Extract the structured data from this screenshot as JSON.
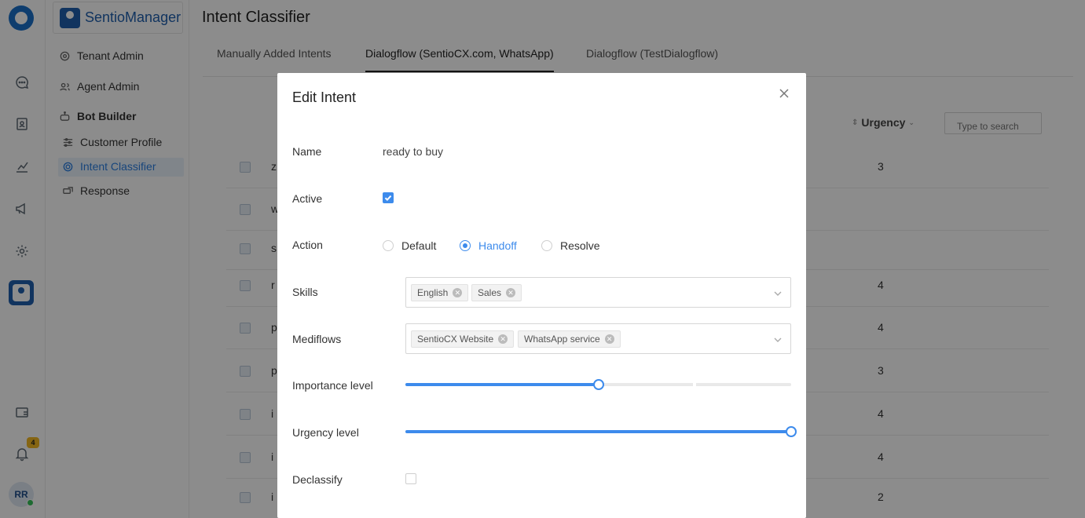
{
  "nav": {
    "brand": "SentioManager",
    "items": [
      {
        "label": "Tenant Admin",
        "icon": "gear-icon"
      },
      {
        "label": "Agent Admin",
        "icon": "users-icon"
      },
      {
        "label": "Bot Builder",
        "icon": "robot-icon"
      },
      {
        "label": "Customer Profile",
        "icon": "sliders-icon"
      },
      {
        "label": "Intent Classifier",
        "icon": "target-icon"
      },
      {
        "label": "Response",
        "icon": "response-icon"
      }
    ],
    "active_item": "Intent Classifier",
    "notification_count": "4",
    "avatar_initials": "RR"
  },
  "main": {
    "title": "Intent Classifier",
    "tabs": [
      "Manually Added Intents",
      "Dialogflow (SentioCX.com, WhatsApp)",
      "Dialogflow (TestDialogflow)"
    ],
    "active_tab": 1,
    "columns": {
      "urgency": "Urgency"
    },
    "search_placeholder": "Type to search",
    "rows": [
      {
        "name_initial": "z",
        "urgency": "3"
      },
      {
        "name_initial": "w",
        "urgency": ""
      },
      {
        "name_initial": "s",
        "urgency": ""
      },
      {
        "name_initial": "r",
        "urgency": "4"
      },
      {
        "name_initial": "p",
        "urgency": "4"
      },
      {
        "name_initial": "p",
        "urgency": "3"
      },
      {
        "name_initial": "i",
        "urgency": "4"
      },
      {
        "name_initial": "i",
        "urgency": "4"
      },
      {
        "name_initial": "i",
        "urgency": "2"
      }
    ]
  },
  "modal": {
    "title": "Edit Intent",
    "name_label": "Name",
    "name_value": "ready to buy",
    "active_label": "Active",
    "active_checked": true,
    "action_label": "Action",
    "action_options": [
      "Default",
      "Handoff",
      "Resolve"
    ],
    "action_selected": "Handoff",
    "skills_label": "Skills",
    "skills": [
      "English",
      "Sales"
    ],
    "mediflows_label": "Mediflows",
    "mediflows": [
      "SentioCX Website",
      "WhatsApp service"
    ],
    "importance_label": "Importance level",
    "importance_fraction": 0.5,
    "urgency_label": "Urgency level",
    "urgency_fraction": 1.0,
    "declassify_label": "Declassify",
    "declassify_checked": false
  },
  "colors": {
    "accent": "#3d8bec",
    "brand": "#1f5fae",
    "overlay": "rgba(0,0,0,0.45)"
  }
}
